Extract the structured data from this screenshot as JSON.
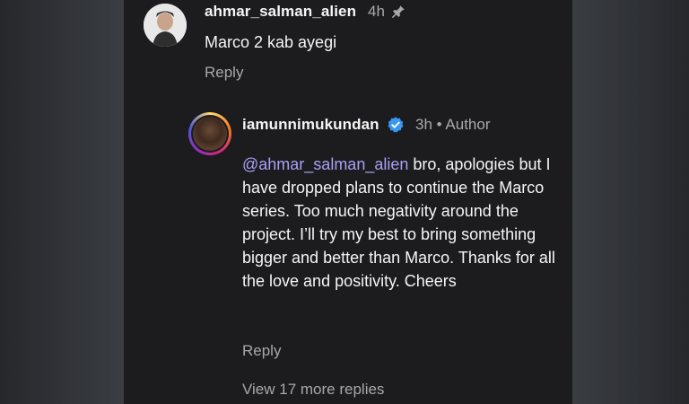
{
  "comment": {
    "username": "ahmar_salman_alien",
    "time": "4h",
    "text": "Marco 2 kab ayegi",
    "reply_label": "Reply"
  },
  "reply": {
    "username": "iamunnimukundan",
    "time": "3h",
    "author_badge": "Author",
    "separator": "•",
    "mention": "@ahmar_salman_alien",
    "text": " bro, apologies but I have dropped plans to continue the Marco series. Too much negativity around the project. I’ll try my best to bring something bigger and better than Marco. Thanks for all the love and positivity. Cheers",
    "reply_label": "Reply"
  },
  "view_more": "View 17 more replies",
  "colors": {
    "background": "#1c1c1e",
    "mention": "#a7a0f6",
    "verified": "#3897f0",
    "muted": "#a8a8a8"
  },
  "icons": {
    "pin": "pin-icon",
    "verified": "verified-badge-icon"
  }
}
